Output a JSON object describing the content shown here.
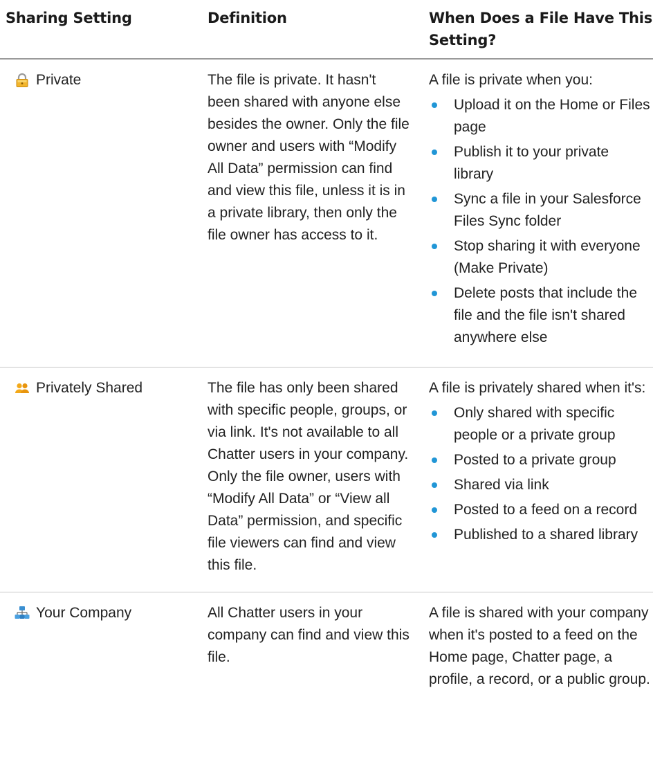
{
  "table": {
    "headers": {
      "sharing_setting": "Sharing Setting",
      "definition": "Definition",
      "when": "When Does a File Have This Setting?"
    },
    "rows": [
      {
        "setting": "Private",
        "icon": "lock-icon",
        "definition": "The file is private. It hasn't been shared with anyone else besides the owner. Only the file owner and users with “Modify All Data” permission can find and view this file, unless it is in a private library, then only the file owner has access to it.",
        "when_intro": "A file is private when you:",
        "when_items": [
          "Upload it on the Home or Files page",
          "Publish it to your private library",
          "Sync a file in your Salesforce Files Sync folder",
          "Stop sharing it with everyone (Make Private)",
          "Delete posts that include the file and the file isn't shared anywhere else"
        ]
      },
      {
        "setting": "Privately Shared",
        "icon": "people-icon",
        "definition": "The file has only been shared with specific people, groups, or via link. It's not available to all Chatter users in your company. Only the file owner, users with “Modify All Data” or “View all Data” permission, and specific file viewers can find and view this file.",
        "when_intro": "A file is privately shared when it's:",
        "when_items": [
          "Only shared with specific people or a private group",
          "Posted to a private group",
          "Shared via link",
          "Posted to a feed on a record",
          "Published to a shared library"
        ]
      },
      {
        "setting": "Your Company",
        "icon": "org-chart-icon",
        "definition": "All Chatter users in your company can find and view this file.",
        "when_intro": "A file is shared with your company when it's posted to a feed on the Home page, Chatter page, a profile, a record, or a public group.",
        "when_items": []
      }
    ]
  },
  "colors": {
    "bullet": "#2196d6",
    "lock": "#e8a820",
    "people": "#f0a416",
    "org": "#3a8fd1"
  }
}
